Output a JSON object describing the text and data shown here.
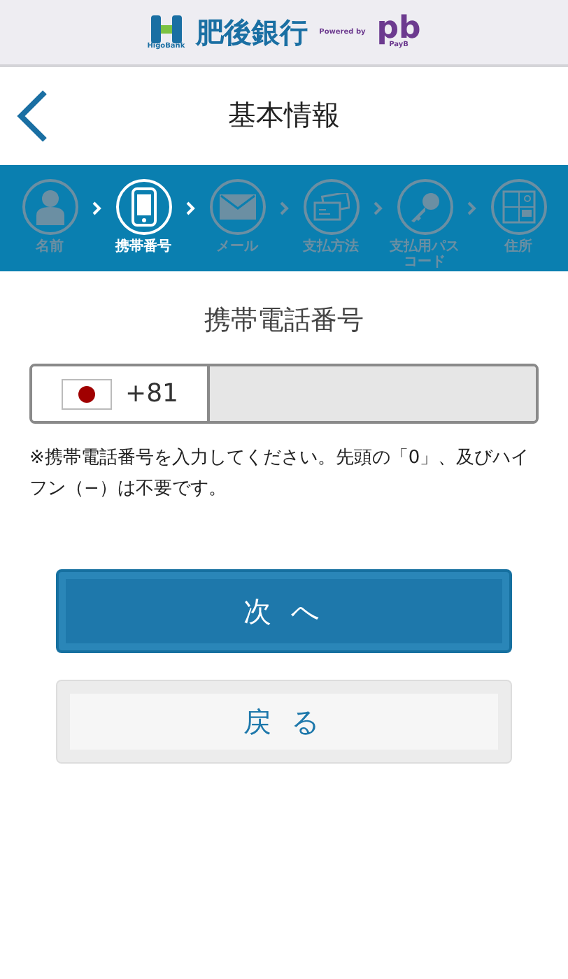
{
  "brand": {
    "name": "肥後銀行",
    "sub": "HigoBank",
    "powered": "Powered by",
    "mark": "pb",
    "mark_sub": "PayB"
  },
  "title": "基本情報",
  "steps": [
    {
      "kind": "person",
      "label": "名前",
      "selected": false
    },
    {
      "kind": "phone",
      "label": "携帯番号",
      "selected": true
    },
    {
      "kind": "mail",
      "label": "メール",
      "selected": false
    },
    {
      "kind": "card",
      "label": "支払方法",
      "selected": false
    },
    {
      "kind": "key",
      "label": "支払用パスコード",
      "selected": false
    },
    {
      "kind": "map",
      "label": "住所",
      "selected": false
    }
  ],
  "field_label": "携帯電話番号",
  "phone": {
    "code": "+81"
  },
  "note": "※携帯電話番号を入力してください。先頭の「0」、及びハイフン（−）は不要です。",
  "buttons": [
    {
      "kind": "primary",
      "label": "次 へ"
    },
    {
      "kind": "secondary",
      "label": "戻 る"
    }
  ]
}
